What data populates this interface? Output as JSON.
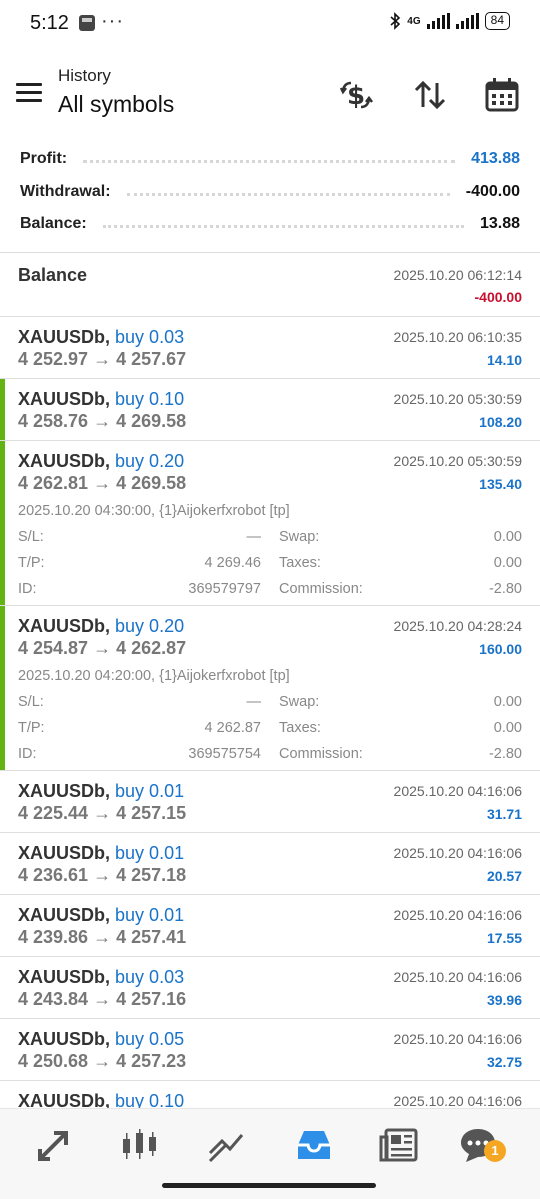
{
  "status_bar": {
    "time": "5:12",
    "dots": "···",
    "network": "4G",
    "battery": "84"
  },
  "header": {
    "subtitle": "History",
    "title": "All symbols"
  },
  "header_icons": [
    "dollar-sort-icon",
    "sort-arrows-icon",
    "calendar-icon"
  ],
  "summary": {
    "profit_label": "Profit:",
    "profit_value": "413.88",
    "withdrawal_label": "Withdrawal:",
    "withdrawal_value": "-400.00",
    "balance_label": "Balance:",
    "balance_value": "13.88"
  },
  "balance_entry": {
    "label": "Balance",
    "time": "2025.10.20 06:12:14",
    "amount": "-400.00"
  },
  "detail_labels": {
    "sl": "S/L:",
    "tp": "T/P:",
    "id": "ID:",
    "swap": "Swap:",
    "taxes": "Taxes:",
    "commission": "Commission:"
  },
  "trades": [
    {
      "symbol": "XAUUSDb,",
      "side": "buy 0.03",
      "prices": "4 252.97 → 4 257.67",
      "time": "2025.10.20 06:10:35",
      "profit": "14.10",
      "marked": false
    },
    {
      "symbol": "XAUUSDb,",
      "side": "buy 0.10",
      "prices": "4 258.76 → 4 269.58",
      "time": "2025.10.20 05:30:59",
      "profit": "108.20",
      "marked": true
    },
    {
      "symbol": "XAUUSDb,",
      "side": "buy 0.20",
      "prices": "4 262.81 → 4 269.58",
      "time": "2025.10.20 05:30:59",
      "profit": "135.40",
      "marked": true,
      "details": {
        "comment": "2025.10.20 04:30:00, {1}Aijokerfxrobot [tp]",
        "sl": "—",
        "tp": "4 269.46",
        "id": "369579797",
        "swap": "0.00",
        "taxes": "0.00",
        "commission": "-2.80"
      }
    },
    {
      "symbol": "XAUUSDb,",
      "side": "buy 0.20",
      "prices": "4 254.87 → 4 262.87",
      "time": "2025.10.20 04:28:24",
      "profit": "160.00",
      "marked": true,
      "details": {
        "comment": "2025.10.20 04:20:00, {1}Aijokerfxrobot [tp]",
        "sl": "—",
        "tp": "4 262.87",
        "id": "369575754",
        "swap": "0.00",
        "taxes": "0.00",
        "commission": "-2.80"
      }
    },
    {
      "symbol": "XAUUSDb,",
      "side": "buy 0.01",
      "prices": "4 225.44 → 4 257.15",
      "time": "2025.10.20 04:16:06",
      "profit": "31.71",
      "marked": false
    },
    {
      "symbol": "XAUUSDb,",
      "side": "buy 0.01",
      "prices": "4 236.61 → 4 257.18",
      "time": "2025.10.20 04:16:06",
      "profit": "20.57",
      "marked": false
    },
    {
      "symbol": "XAUUSDb,",
      "side": "buy 0.01",
      "prices": "4 239.86 → 4 257.41",
      "time": "2025.10.20 04:16:06",
      "profit": "17.55",
      "marked": false
    },
    {
      "symbol": "XAUUSDb,",
      "side": "buy 0.03",
      "prices": "4 243.84 → 4 257.16",
      "time": "2025.10.20 04:16:06",
      "profit": "39.96",
      "marked": false
    },
    {
      "symbol": "XAUUSDb,",
      "side": "buy 0.05",
      "prices": "4 250.68 → 4 257.23",
      "time": "2025.10.20 04:16:06",
      "profit": "32.75",
      "marked": false
    },
    {
      "symbol": "XAUUSDb,",
      "side": "buy 0.10",
      "prices": "",
      "time": "2025.10.20 04:16:06",
      "profit": "",
      "marked": false
    }
  ],
  "colors": {
    "accent_blue": "#1a73c9",
    "negative_red": "#c8102e",
    "marker_green": "#62b313",
    "badge_orange": "#f5a623"
  },
  "bottom_nav": {
    "items": [
      "quotes-icon",
      "chart-icon",
      "trade-icon",
      "history-icon",
      "news-icon",
      "chat-icon"
    ],
    "active": "history-icon",
    "chat_badge": "1"
  }
}
